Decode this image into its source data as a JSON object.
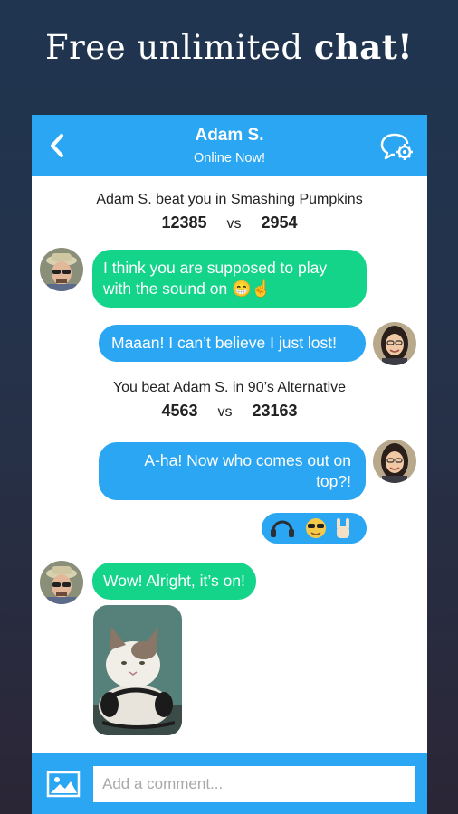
{
  "promo": {
    "headline_prefix": "Free unlimited ",
    "headline_bold": "chat!"
  },
  "chat_header": {
    "back_icon": "chevron-left-icon",
    "name": "Adam S.",
    "status": "Online Now!",
    "settings_icon": "chat-settings-icon"
  },
  "messages": {
    "result_1": {
      "text": "Adam S. beat you in Smashing Pumpkins",
      "score_left": "12385",
      "vs": "vs",
      "score_right": "2954"
    },
    "msg_1": {
      "text": "I think you are supposed to play with the sound on",
      "emoji": "😁☝"
    },
    "msg_2": {
      "text": "Maaan! I can’t believe I just lost!"
    },
    "result_2": {
      "text": "You beat Adam S. in 90’s Alternative",
      "score_left": "4563",
      "vs": "vs",
      "score_right": "23163"
    },
    "msg_3": {
      "text": "A-ha! Now who comes out on top?!"
    },
    "msg_4": {
      "emoji": [
        "headphones-icon",
        "sunglasses-face-icon",
        "rock-hand-icon"
      ]
    },
    "msg_5": {
      "text": "Wow! Alright, it’s on!"
    },
    "msg_6": {
      "image": "cat-with-headphones-photo"
    }
  },
  "composer": {
    "image_icon": "image-icon",
    "placeholder": "Add a comment..."
  },
  "colors": {
    "accent_blue": "#2aa6f2",
    "bubble_green": "#14d48a"
  }
}
